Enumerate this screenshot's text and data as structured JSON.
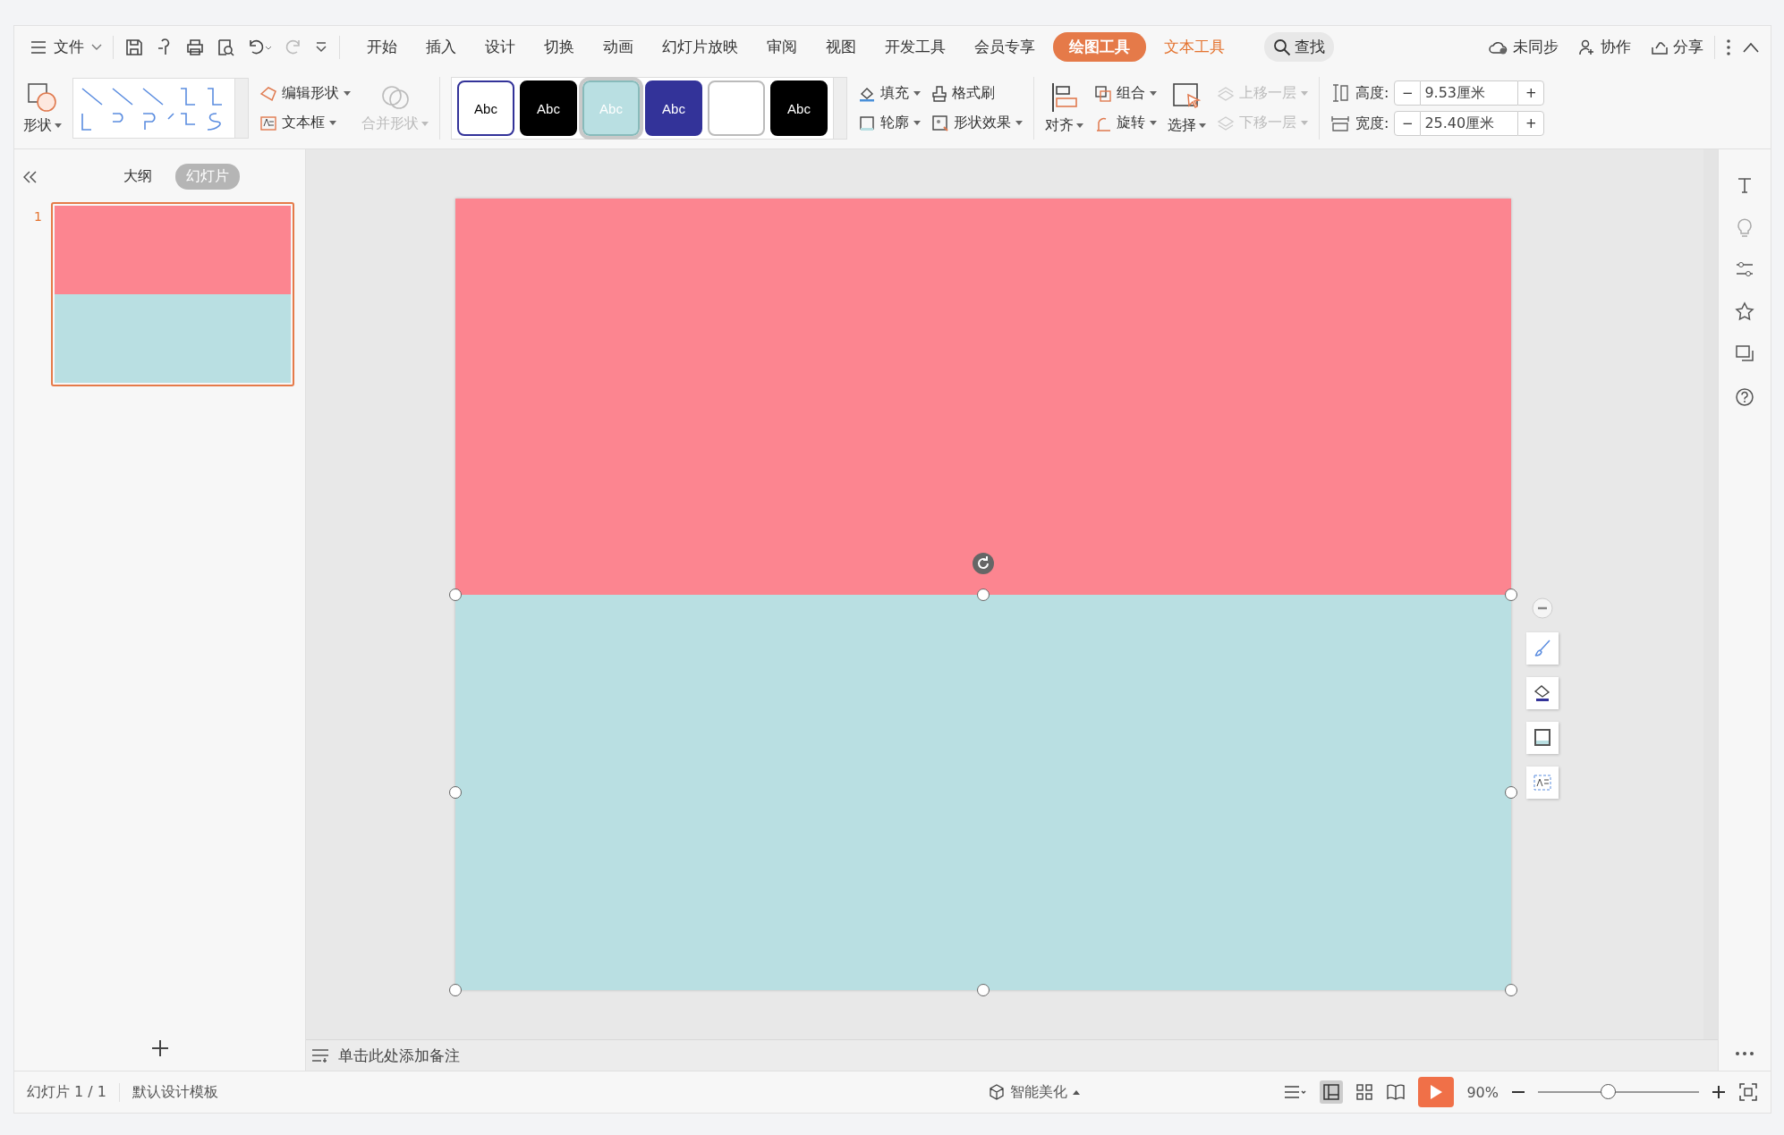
{
  "menu": {
    "file": "文件",
    "tabs": [
      {
        "label": "开始",
        "selected": false,
        "kind": "tab"
      },
      {
        "label": "插入",
        "selected": false,
        "kind": "tab"
      },
      {
        "label": "设计",
        "selected": false,
        "kind": "tab"
      },
      {
        "label": "切换",
        "selected": false,
        "kind": "tab"
      },
      {
        "label": "动画",
        "selected": false,
        "kind": "tab"
      },
      {
        "label": "幻灯片放映",
        "selected": false,
        "kind": "tab"
      },
      {
        "label": "审阅",
        "selected": false,
        "kind": "tab"
      },
      {
        "label": "视图",
        "selected": false,
        "kind": "tab"
      },
      {
        "label": "开发工具",
        "selected": false,
        "kind": "tab"
      },
      {
        "label": "会员专享",
        "selected": false,
        "kind": "tab"
      },
      {
        "label": "绘图工具",
        "selected": true,
        "kind": "context"
      },
      {
        "label": "文本工具",
        "selected": false,
        "kind": "context"
      }
    ],
    "search": "查找",
    "sync": "未同步",
    "collaborate": "协作",
    "share": "分享"
  },
  "ribbon": {
    "shape": "形状",
    "edit_shape": "编辑形状",
    "textbox": "文本框",
    "merge": {
      "label": "合并形状",
      "disabled": true
    },
    "styles": [
      {
        "label": "Abc",
        "color": "#ffffff",
        "selected": false
      },
      {
        "label": "Abc",
        "color": "#000000",
        "selected": false
      },
      {
        "label": "Abc",
        "color": "#b9dfe2",
        "selected": true
      },
      {
        "label": "Abc",
        "color": "#333399",
        "selected": false
      },
      {
        "color": "#ffffff",
        "selected": false
      },
      {
        "label": "Abc",
        "color": "#000000",
        "selected": false
      }
    ],
    "fill": "填充",
    "format_painter": "格式刷",
    "outline": "轮廓",
    "effects": "形状效果",
    "align": "对齐",
    "group": "组合",
    "rotate": "旋转",
    "select": "选择",
    "bring_forward": {
      "label": "上移一层",
      "disabled": true
    },
    "send_backward": {
      "label": "下移一层",
      "disabled": true
    },
    "height": {
      "label": "高度:",
      "value": "9.53厘米",
      "minus": "−",
      "plus": "+"
    },
    "width": {
      "label": "宽度:",
      "value": "25.40厘米",
      "minus": "−",
      "plus": "+"
    }
  },
  "panel": {
    "tabs": [
      {
        "label": "大纲",
        "selected": false
      },
      {
        "label": "幻灯片",
        "selected": true
      }
    ],
    "slides": [
      {
        "number": "1",
        "selected": true
      }
    ]
  },
  "slide": {
    "shapes": [
      {
        "color": "#fc8590",
        "selected": false
      },
      {
        "color": "#b9dfe2",
        "selected": true
      }
    ]
  },
  "notes": {
    "placeholder": "单击此处添加备注"
  },
  "status_bar": {
    "slide_count": "幻灯片 1 / 1",
    "template": "默认设计模板",
    "beautify": "智能美化",
    "zoom": "90%",
    "zoom_level": {
      "level": 0.44
    }
  }
}
